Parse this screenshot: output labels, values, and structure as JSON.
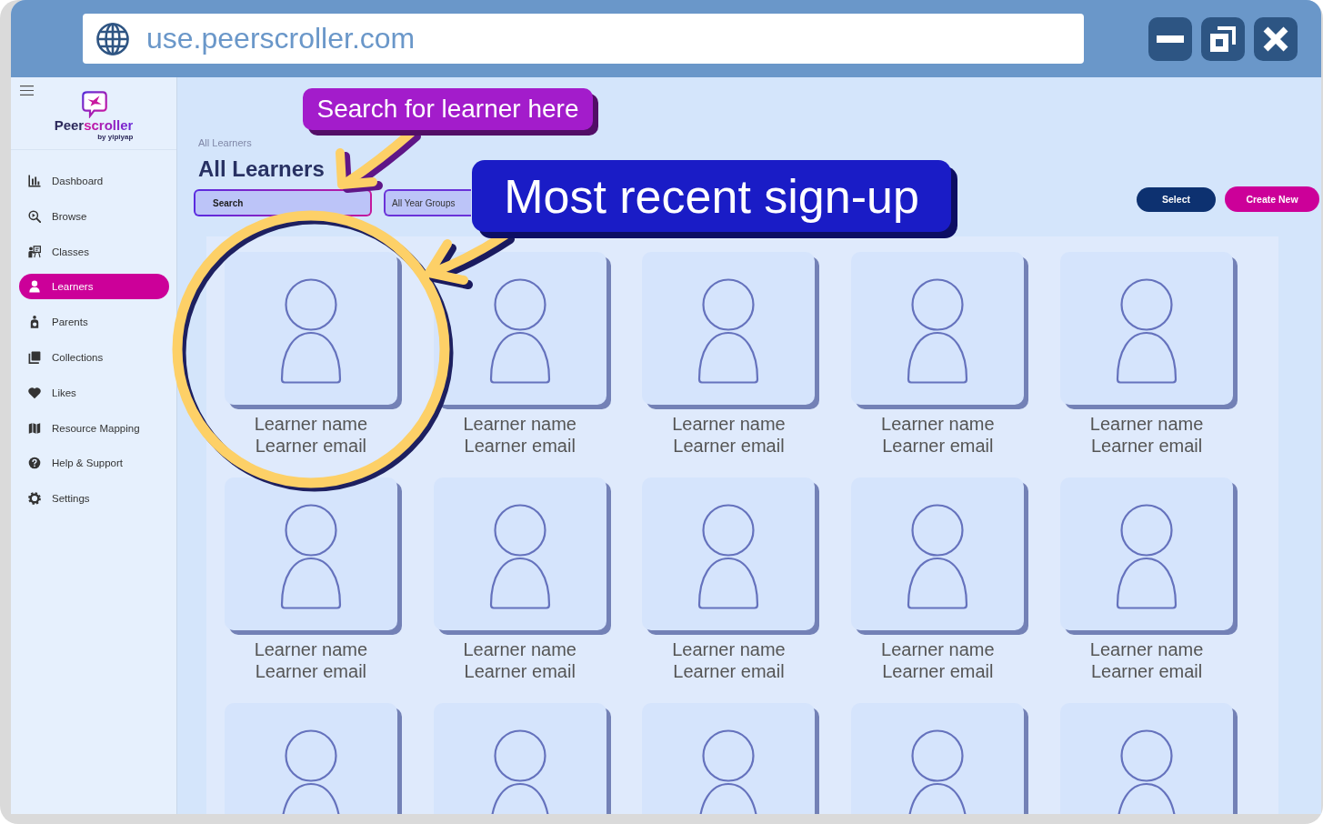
{
  "browser": {
    "url": "use.peerscroller.com"
  },
  "sidebar": {
    "logo": {
      "wordmark": [
        "Peer",
        "scroller"
      ],
      "byline": "by yipiyap"
    },
    "items": [
      {
        "label": "Dashboard",
        "selected": false
      },
      {
        "label": "Browse",
        "selected": false
      },
      {
        "label": "Classes",
        "selected": false
      },
      {
        "label": "Learners",
        "selected": true
      },
      {
        "label": "Parents",
        "selected": false
      },
      {
        "label": "Collections",
        "selected": false
      },
      {
        "label": "Likes",
        "selected": false
      },
      {
        "label": "Resource Mapping",
        "selected": false
      },
      {
        "label": "Help & Support",
        "selected": false
      },
      {
        "label": "Settings",
        "selected": false
      }
    ]
  },
  "page": {
    "breadcrumb": "All Learners",
    "title": "All Learners",
    "search": {
      "placeholder": "Search"
    },
    "year_filter": {
      "value": "All Year Groups"
    },
    "buttons": [
      {
        "label": "Select",
        "kind": "secondary"
      },
      {
        "label": "Create New",
        "kind": "primary"
      }
    ]
  },
  "learners": [
    {
      "kind": "full",
      "name": "Learner name",
      "email": "Learner email"
    },
    {
      "kind": "full",
      "name": "Learner name",
      "email": "Learner email"
    },
    {
      "kind": "full",
      "name": "Learner name",
      "email": "Learner email"
    },
    {
      "kind": "full",
      "name": "Learner name",
      "email": "Learner email"
    },
    {
      "kind": "full",
      "name": "Learner name",
      "email": "Learner email"
    },
    {
      "kind": "full",
      "name": "Learner name",
      "email": "Learner email"
    },
    {
      "kind": "full",
      "name": "Learner name",
      "email": "Learner email"
    },
    {
      "kind": "full",
      "name": "Learner name",
      "email": "Learner email"
    },
    {
      "kind": "full",
      "name": "Learner name",
      "email": "Learner email"
    },
    {
      "kind": "full",
      "name": "Learner name",
      "email": "Learner email"
    },
    {
      "kind": "partial"
    },
    {
      "kind": "partial"
    },
    {
      "kind": "partial"
    },
    {
      "kind": "partial"
    },
    {
      "kind": "partial"
    }
  ],
  "annotations": [
    {
      "text": "Search for learner here",
      "color": "#a31ccb"
    },
    {
      "text": "Most recent sign-up",
      "color": "#1a1cc6"
    }
  ]
}
